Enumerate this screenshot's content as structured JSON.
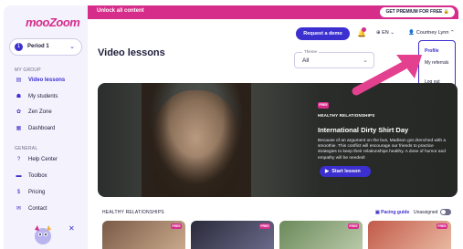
{
  "banner": {
    "text": "Unlock all content",
    "premium_label": "GET PREMIUM FOR FREE 🔒"
  },
  "sidebar": {
    "logo": "mooZoom",
    "period_number": "1",
    "period_label": "Period 1",
    "my_group_label": "MY GROUP",
    "general_label": "GENERAL",
    "items": [
      {
        "label": "Video lessons",
        "icon": "film-icon",
        "glyph": "▤"
      },
      {
        "label": "My students",
        "icon": "students-icon",
        "glyph": "☗"
      },
      {
        "label": "Zen Zone",
        "icon": "zen-icon",
        "glyph": "✿"
      },
      {
        "label": "Dashboard",
        "icon": "dashboard-icon",
        "glyph": "▦"
      },
      {
        "label": "Help Center",
        "icon": "help-icon",
        "glyph": "?"
      },
      {
        "label": "Toolbox",
        "icon": "toolbox-icon",
        "glyph": "▬"
      },
      {
        "label": "Pricing",
        "icon": "pricing-icon",
        "glyph": "$"
      },
      {
        "label": "Contact",
        "icon": "mail-icon",
        "glyph": "✉"
      }
    ]
  },
  "header": {
    "demo_label": "Request a demo",
    "lang_label": "⊕ EN ⌄",
    "user_name": "Courtney Lynn",
    "user_chevron": "⌃"
  },
  "dropdown": {
    "items": [
      "Profile",
      "My referrals",
      "Log out"
    ]
  },
  "main": {
    "title": "Video lessons",
    "theme_legend": "Theme",
    "theme_value": "All",
    "hero": {
      "badge": "FREE",
      "category": "HEALTHY RELATIONSHIPS",
      "title": "International Dirty Shirt Day",
      "description": "Because of an argument on the bus, Madison got drenched with a smoothie. This conflict will encourage our friends to practice strategies to keep their relationships healthy. A dose of humor and empathy will be needed!",
      "start_label": "Start lesson"
    },
    "row": {
      "label": "HEALTHY RELATIONSHIPS",
      "pacing_label": "Pacing guide",
      "unassigned_label": "Unassigned",
      "thumbnails": [
        {
          "badge": "FREE",
          "color_a": "#7a5a46",
          "color_b": "#c9a98b"
        },
        {
          "badge": "FREE",
          "color_a": "#2a2a3a",
          "color_b": "#6a6a8a"
        },
        {
          "badge": "FREE",
          "color_a": "#6b8a5a",
          "color_b": "#b8c8a8"
        },
        {
          "badge": "FREE",
          "color_a": "#c25a4a",
          "color_b": "#e8b8a0"
        }
      ]
    }
  },
  "colors": {
    "brand_pink": "#d62d8b",
    "brand_purple": "#3c2fd0",
    "sidebar_bg": "#f4f2fc"
  }
}
